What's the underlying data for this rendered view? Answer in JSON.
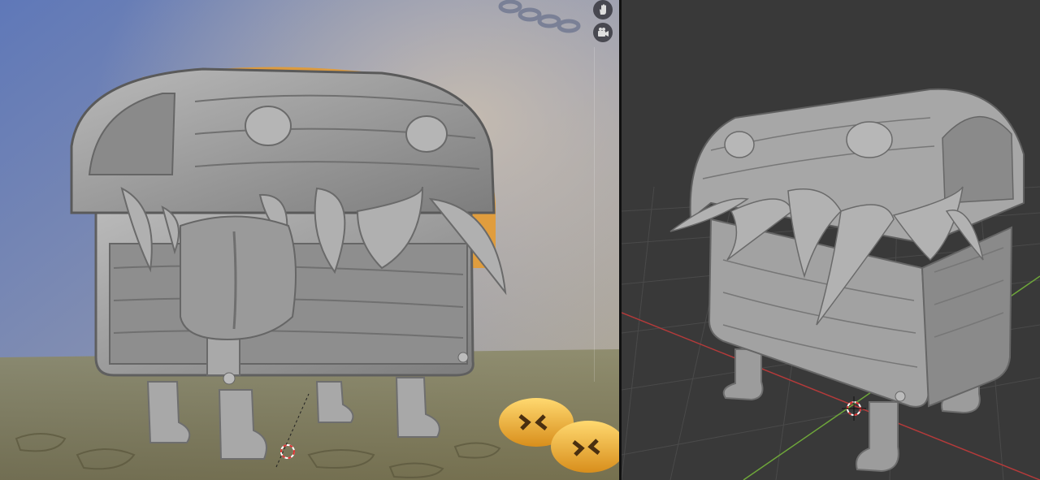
{
  "window": {
    "title": ""
  },
  "left_viewport": {
    "render_mode": "rendered",
    "background": "#6f7ea8",
    "nav_tools": [
      {
        "name": "pan-view",
        "icon": "hand-icon"
      },
      {
        "name": "camera-view",
        "icon": "camera-icon"
      }
    ]
  },
  "right_viewport": {
    "render_mode": "solid",
    "background": "#3a3a3a",
    "grid": true,
    "axis_colors": {
      "x": "#c0392b",
      "y": "#6ea63a"
    }
  },
  "colors": {
    "sculpt_gray": "#9a9a9a",
    "gold_coin": "#f2b838",
    "divider": "#111111"
  }
}
